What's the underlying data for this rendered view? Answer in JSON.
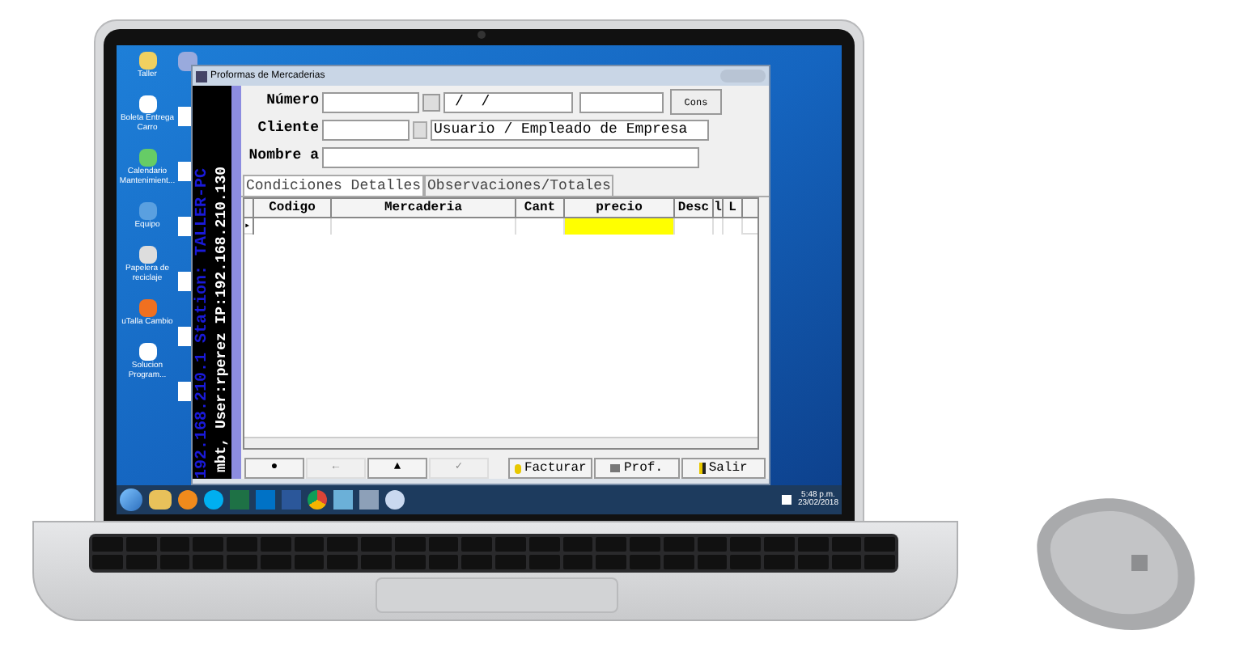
{
  "desktop_icons": [
    {
      "label": "Taller"
    },
    {
      "label": "Boleta Entrega Carro"
    },
    {
      "label": "Calendario Mantenimient..."
    },
    {
      "label": "Equipo"
    },
    {
      "label": "Papelera de reciclaje"
    },
    {
      "label": "uTalla Cambio"
    },
    {
      "label": "Solucion Program..."
    }
  ],
  "window": {
    "title": "Proformas de Mercaderias"
  },
  "sidebar": {
    "station_text": "192.168.210.1 Station: TALLER-PC",
    "user_text": "mbt, User:rperez  IP:192.168.210.130"
  },
  "fields": [
    {
      "label": "Número"
    },
    {
      "label": "Cliente"
    },
    {
      "label": "Nombre a"
    }
  ],
  "date_field": {
    "value": "/  /"
  },
  "cons_button": {
    "label": "Cons"
  },
  "client_name": {
    "value": "Usuario / Empleado de Empresa"
  },
  "tabs": [
    {
      "label": "Condiciones Detalles",
      "selected": true
    },
    {
      "label": "Observaciones/Totales",
      "selected": false
    }
  ],
  "grid": {
    "row_marker": "▸",
    "columns": [
      {
        "label": "Codigo",
        "highlighted": false
      },
      {
        "label": "Mercaderia",
        "highlighted": false
      },
      {
        "label": "Cant",
        "highlighted": false
      },
      {
        "label": "precio",
        "highlighted": true
      },
      {
        "label": "Desc",
        "highlighted": false
      },
      {
        "label": "l",
        "highlighted": false
      },
      {
        "label": "L",
        "highlighted": false
      }
    ]
  },
  "nav_buttons": [
    {
      "symbol": "●",
      "disabled": false
    },
    {
      "symbol": "←",
      "disabled": true
    },
    {
      "symbol": "▲",
      "disabled": false
    },
    {
      "symbol": "✓",
      "disabled": true
    }
  ],
  "action_buttons": [
    {
      "label": "Facturar",
      "kind": "invoice"
    },
    {
      "label": "Prof.",
      "kind": "print"
    },
    {
      "label": "Salir",
      "kind": "exit"
    }
  ],
  "clock": {
    "time": "5:48 p.m.",
    "date": "23/02/2018"
  }
}
